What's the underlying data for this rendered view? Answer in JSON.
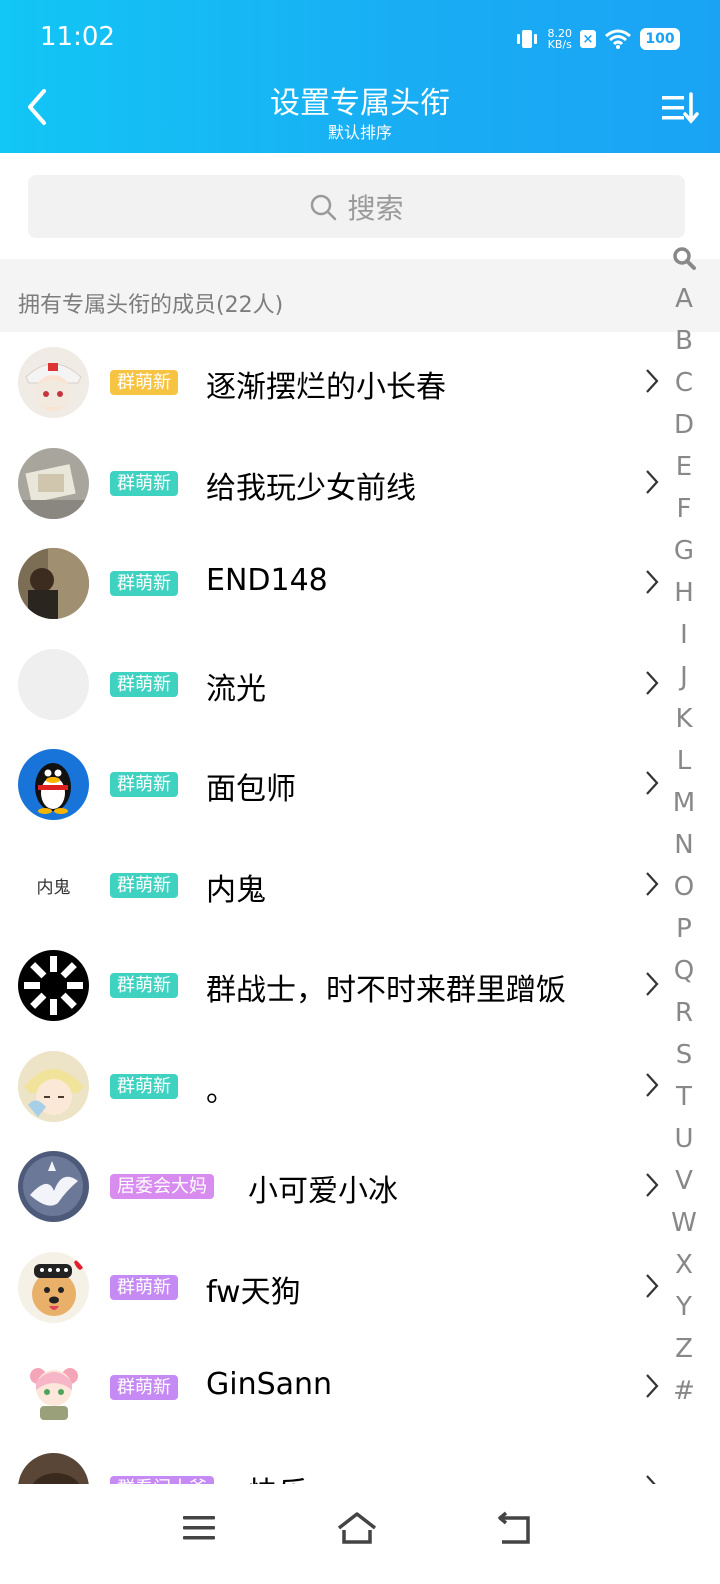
{
  "status": {
    "time": "11:02",
    "speed_value": "8.20",
    "speed_unit": "KB/s",
    "battery": "100"
  },
  "header": {
    "title": "设置专属头衔",
    "subtitle": "默认排序"
  },
  "search": {
    "label": "搜索"
  },
  "section": {
    "label": "拥有专属头衔的成员(22人)"
  },
  "members": [
    {
      "name": "逐渐摆烂的小长春",
      "badge": "群萌新",
      "badge_color": "#f7c342",
      "avatar": "anime-girl"
    },
    {
      "name": "给我玩少女前线",
      "badge": "群萌新",
      "badge_color": "#3fd2c0",
      "avatar": "photo-items"
    },
    {
      "name": "END148",
      "badge": "群萌新",
      "badge_color": "#3fd2c0",
      "avatar": "photo-person"
    },
    {
      "name": "流光",
      "badge": "群萌新",
      "badge_color": "#3fd2c0",
      "avatar": "blank"
    },
    {
      "name": "面包师",
      "badge": "群萌新",
      "badge_color": "#3fd2c0",
      "avatar": "qq-penguin"
    },
    {
      "name": "内鬼",
      "badge": "群萌新",
      "badge_color": "#3fd2c0",
      "avatar": "text",
      "avatar_text": "内鬼"
    },
    {
      "name": "群战士，时不时来群里蹭饭",
      "badge": "群萌新",
      "badge_color": "#3fd2c0",
      "avatar": "black-white-pattern"
    },
    {
      "name": "。",
      "badge": "群萌新",
      "badge_color": "#3fd2c0",
      "avatar": "anime-blonde"
    },
    {
      "name": "小可爱小冰",
      "badge": "居委会大妈",
      "badge_color": "#d88cf0",
      "avatar": "white-dragon"
    },
    {
      "name": "fw天狗",
      "badge": "群萌新",
      "badge_color": "#c68af5",
      "avatar": "dog"
    },
    {
      "name": "GinSann",
      "badge": "群萌新",
      "badge_color": "#c68af5",
      "avatar": "anime-pink"
    },
    {
      "name": "快乐",
      "badge": "群看门大爷",
      "badge_color": "#c68af5",
      "avatar": "photo-cat"
    }
  ],
  "alphabet": [
    "A",
    "B",
    "C",
    "D",
    "E",
    "F",
    "G",
    "H",
    "I",
    "J",
    "K",
    "L",
    "M",
    "N",
    "O",
    "P",
    "Q",
    "R",
    "S",
    "T",
    "U",
    "V",
    "W",
    "X",
    "Y",
    "Z",
    "#"
  ],
  "colors": {
    "header_start": "#12c6f5",
    "header_end": "#1aa3f4",
    "badge_yellow": "#f7c342",
    "badge_teal": "#3fd2c0",
    "badge_purple": "#c68af5"
  }
}
